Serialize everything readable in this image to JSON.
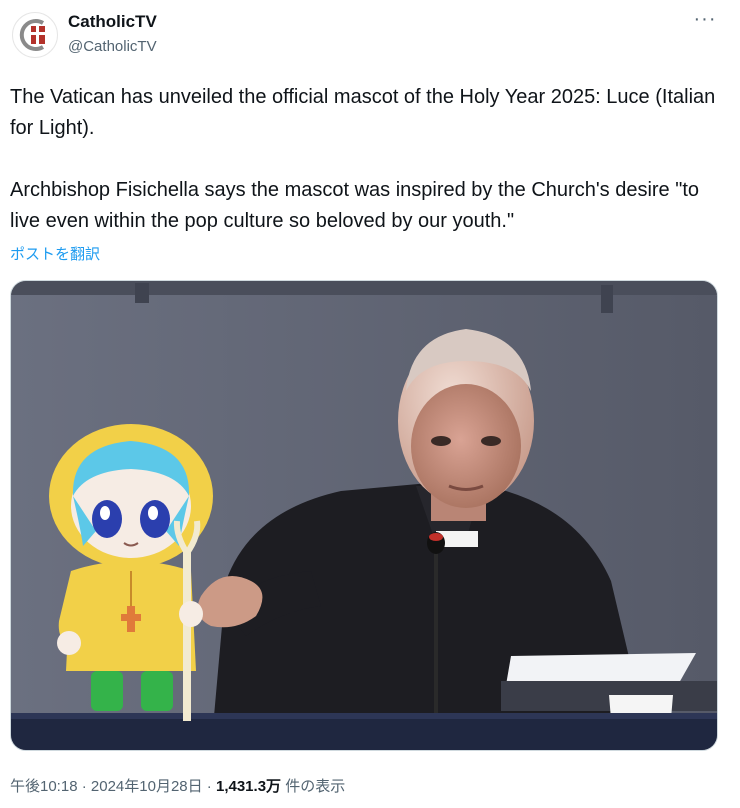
{
  "account": {
    "name": "CatholicTV",
    "handle": "@CatholicTV",
    "avatar_icon": "catholictv-logo-icon"
  },
  "tweet": {
    "paragraph1": "The Vatican has unveiled the official mascot of the Holy Year 2025: Luce (Italian for Light).",
    "paragraph2": "Archbishop Fisichella says the mascot was inspired by the Church's desire \"to live even within the pop culture so beloved by our youth.\"",
    "translate_label": "ポストを翻訳"
  },
  "menu": {
    "more_icon": "more-options-icon",
    "more_label": "···"
  },
  "meta": {
    "time": "午後10:18",
    "separator": " · ",
    "date": "2024年10月28日",
    "views_count": "1,431.3万",
    "views_label": " 件の表示"
  },
  "colors": {
    "link": "#1d9bf0",
    "secondary_text": "#536471",
    "mascot_coat": "#f2d048",
    "mascot_hair": "#5cc8e8",
    "mascot_boots": "#34b34a"
  }
}
